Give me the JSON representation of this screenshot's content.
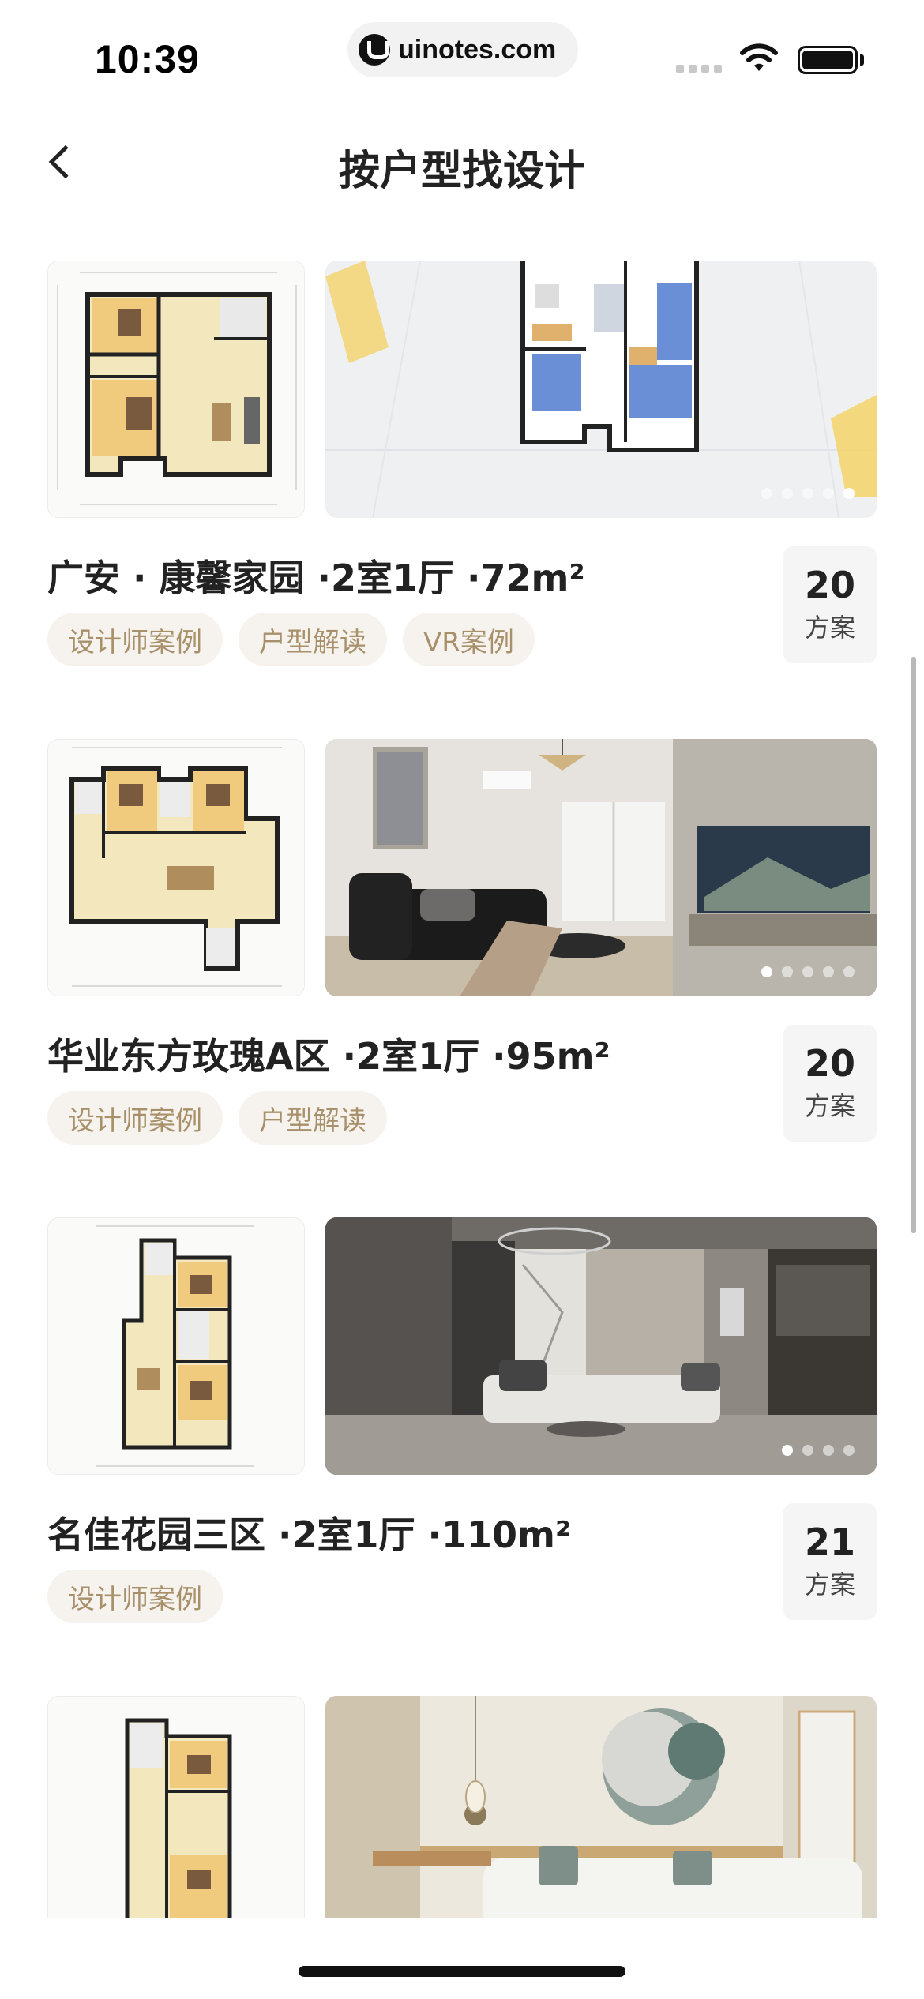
{
  "status_bar": {
    "time": "10:39",
    "url": "uinotes.com",
    "icons": [
      "signal-icon",
      "wifi-icon",
      "battery-icon"
    ]
  },
  "nav": {
    "back_icon": "chevron-left-icon",
    "title": "按户型找设计"
  },
  "colors": {
    "tag_bg": "#f6f3ee",
    "tag_text": "#a8906a",
    "count_bg": "#f5f5f5",
    "title_text": "#222222"
  },
  "listings": [
    {
      "title": "广安 · 康馨家园 ·2室1厅 ·72m²",
      "tags": [
        "设计师案例",
        "户型解读",
        "VR案例"
      ],
      "count": "20",
      "count_unit": "方案",
      "photo_dots": 5,
      "active_dot": 5,
      "photo": "3d-floorplan-render"
    },
    {
      "title": "华业东方玫瑰A区 ·2室1厅 ·95m²",
      "tags": [
        "设计师案例",
        "户型解读"
      ],
      "count": "20",
      "count_unit": "方案",
      "photo_dots": 5,
      "active_dot": 1,
      "photo": "living-room-dark-sofa"
    },
    {
      "title": "名佳花园三区 ·2室1厅 ·110m²",
      "tags": [
        "设计师案例"
      ],
      "count": "21",
      "count_unit": "方案",
      "photo_dots": 4,
      "active_dot": 1,
      "photo": "living-room-grey-curtains"
    },
    {
      "title": "",
      "tags": [],
      "count": "",
      "count_unit": "",
      "photo_dots": 0,
      "active_dot": 0,
      "photo": "living-room-green-pillows"
    }
  ]
}
